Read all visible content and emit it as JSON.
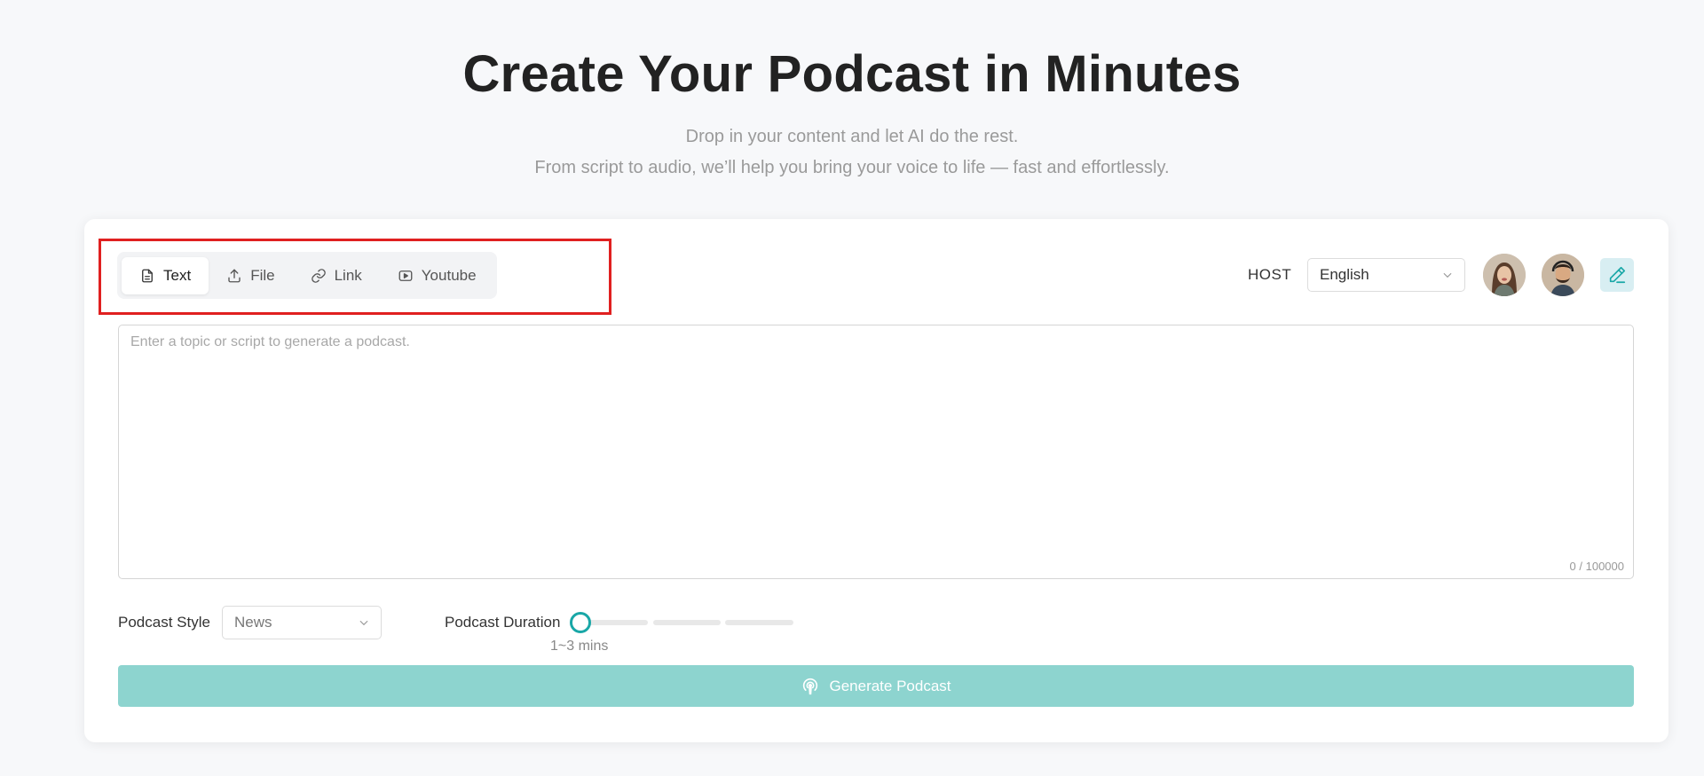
{
  "hero": {
    "title": "Create Your Podcast in Minutes",
    "subtitle_line1": "Drop in your content and let AI do the rest.",
    "subtitle_line2": "From script to audio, we’ll help you bring your voice to life — fast and effortlessly."
  },
  "tabs": [
    {
      "label": "Text",
      "icon": "document-icon",
      "active": true
    },
    {
      "label": "File",
      "icon": "upload-icon",
      "active": false
    },
    {
      "label": "Link",
      "icon": "link-icon",
      "active": false
    },
    {
      "label": "Youtube",
      "icon": "youtube-icon",
      "active": false
    }
  ],
  "host": {
    "label": "HOST",
    "language": "English"
  },
  "editor": {
    "placeholder": "Enter a topic or script to generate a podcast.",
    "value": "",
    "counter": "0 / 100000"
  },
  "options": {
    "style_label": "Podcast Style",
    "style_value": "News",
    "duration_label": "Podcast Duration",
    "duration_value": "1~3 mins"
  },
  "generate": {
    "label": "Generate Podcast"
  },
  "colors": {
    "accent": "#19a7a7",
    "button_disabled": "#8dd4cf",
    "highlight": "#e02020"
  }
}
